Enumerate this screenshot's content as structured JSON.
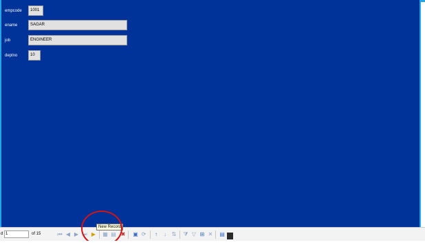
{
  "form": {
    "fields": [
      {
        "label": "empcode",
        "value": "1001"
      },
      {
        "label": "ename",
        "value": "SAGAR"
      },
      {
        "label": "job",
        "value": "ENGINEER"
      },
      {
        "label": "deptno",
        "value": "10"
      }
    ],
    "background_color": "#003399"
  },
  "navigator": {
    "record_label": "d",
    "current_record": "1",
    "of_text": "of 15",
    "buttons": [
      {
        "name": "first-record",
        "icon": "first-icon"
      },
      {
        "name": "previous-record",
        "icon": "previous-icon"
      },
      {
        "name": "next-record",
        "icon": "next-icon"
      },
      {
        "name": "last-record",
        "icon": "last-icon"
      },
      {
        "name": "new-record",
        "icon": "new-record-icon"
      },
      {
        "name": "save-record",
        "icon": "save-icon"
      },
      {
        "name": "undo",
        "icon": "undo-icon"
      },
      {
        "name": "delete-record",
        "icon": "delete-icon"
      },
      {
        "name": "find-record",
        "icon": "find-icon"
      },
      {
        "name": "refresh",
        "icon": "refresh-icon"
      },
      {
        "name": "sort-ascending",
        "icon": "sort-ascending-icon"
      },
      {
        "name": "sort-descending",
        "icon": "sort-descending-icon"
      },
      {
        "name": "sort",
        "icon": "sort-icon"
      },
      {
        "name": "autofilter",
        "icon": "autofilter-icon"
      },
      {
        "name": "apply-filter",
        "icon": "apply-filter-icon"
      },
      {
        "name": "standard-filter",
        "icon": "standard-filter-icon"
      },
      {
        "name": "reset-filter",
        "icon": "reset-filter-icon"
      },
      {
        "name": "data-source",
        "icon": "data-source-icon"
      }
    ]
  },
  "tooltip": {
    "text": "New Record"
  },
  "annotation": {
    "circle_color": "#d41414"
  }
}
